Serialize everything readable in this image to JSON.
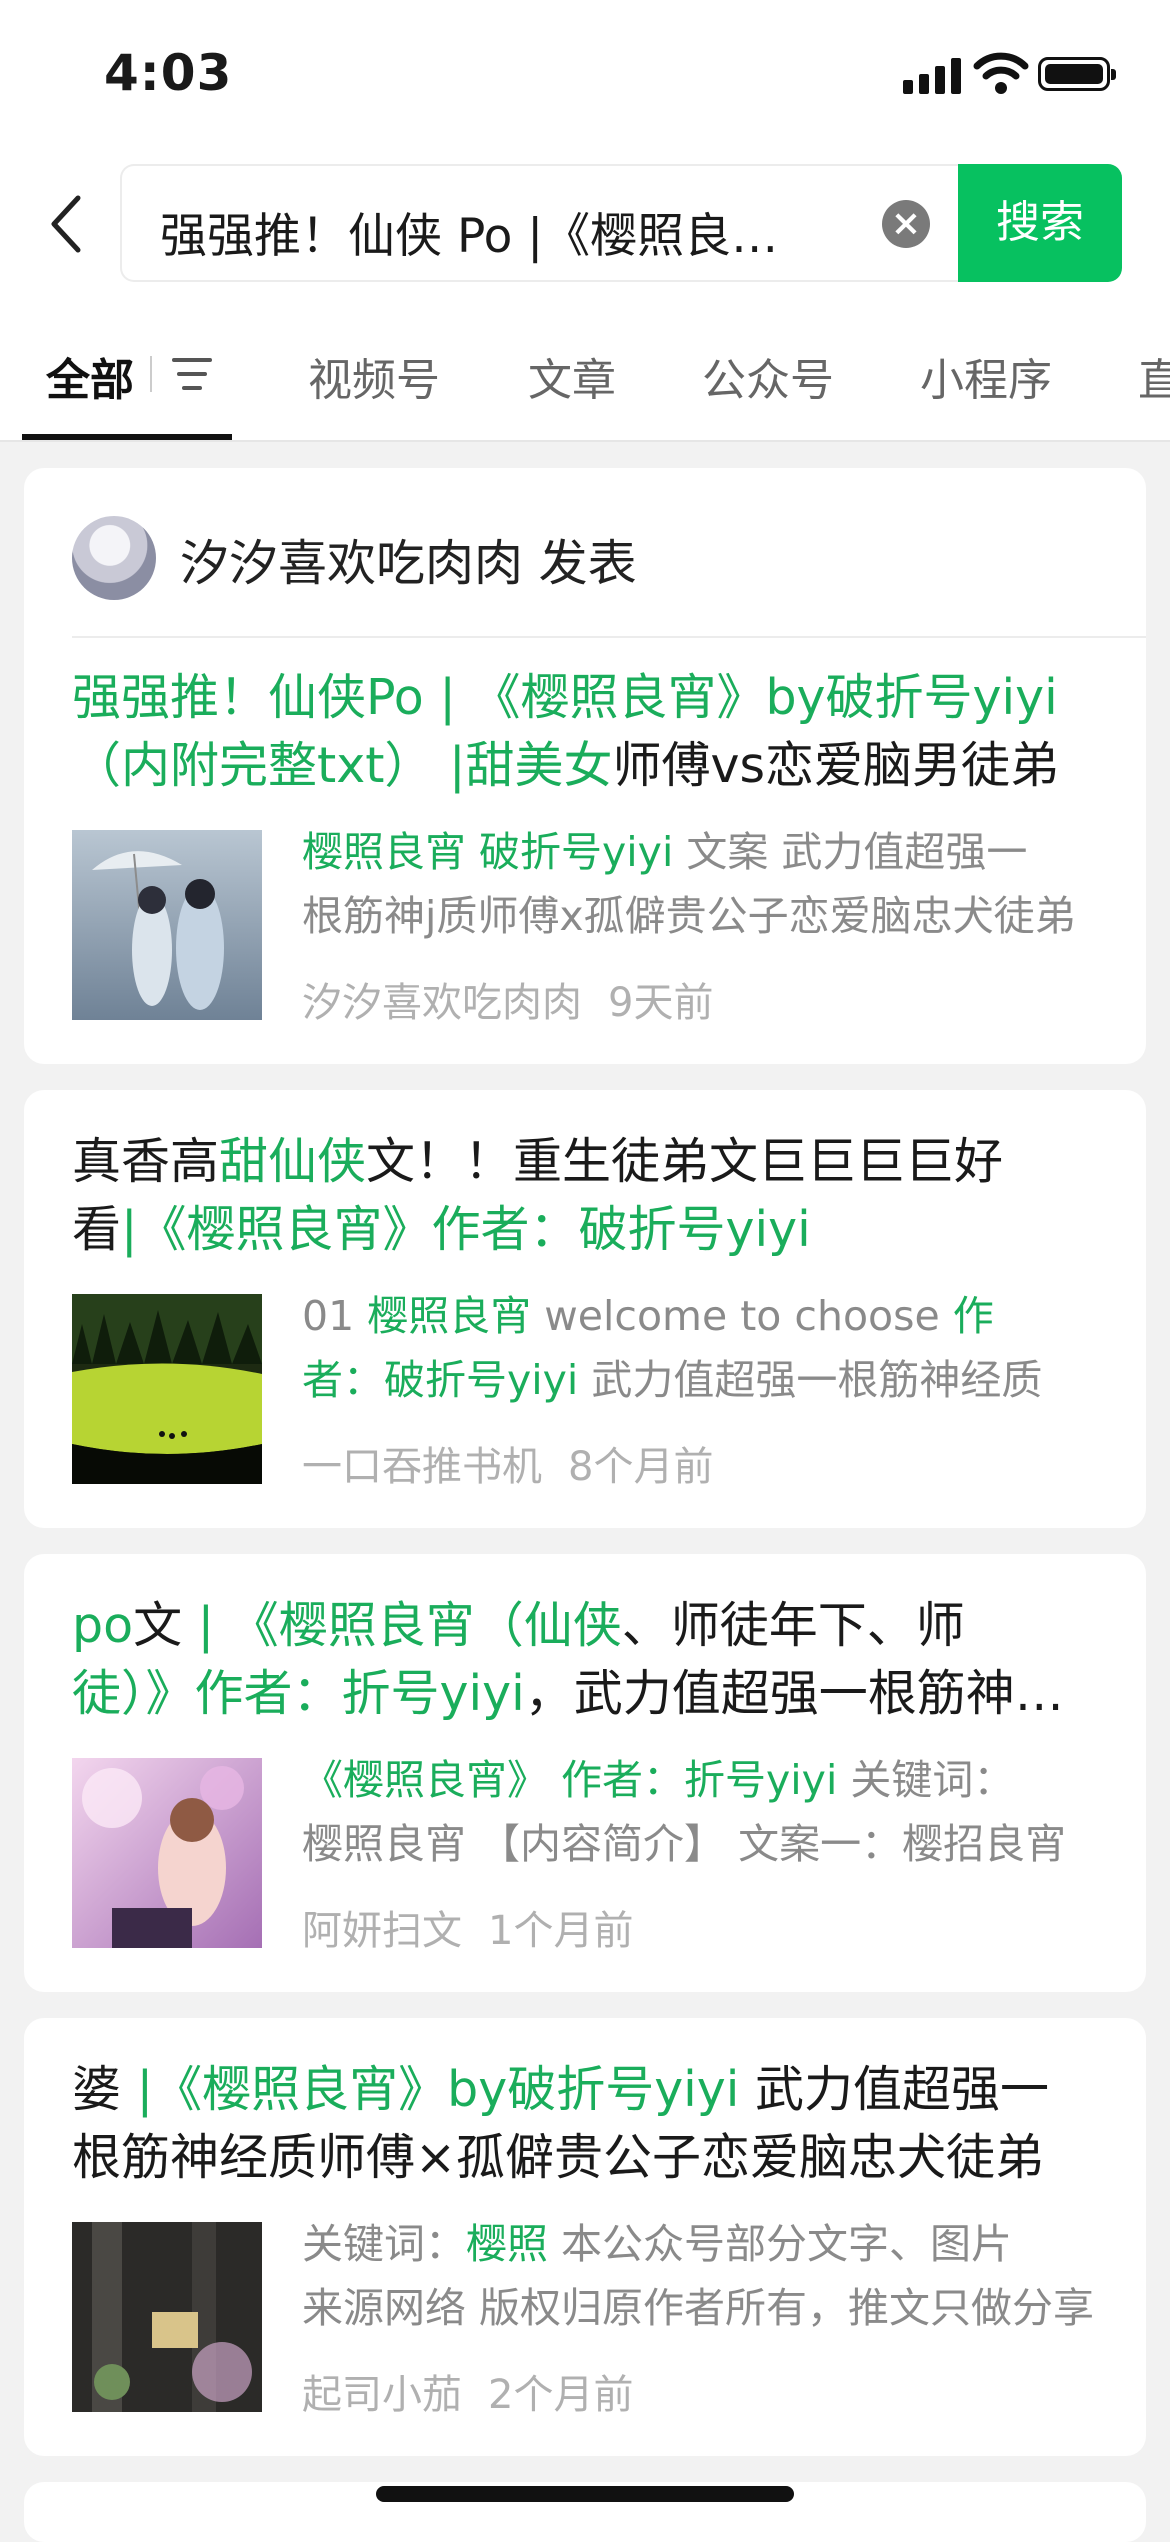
{
  "status_bar": {
    "time": "4:03"
  },
  "search": {
    "query": "强强推！仙侠 Po |《樱照良宵（仙侠、师徒年下、师徒）》",
    "button_label": "搜索"
  },
  "tabs": [
    {
      "label": "全部",
      "active": true
    },
    {
      "label": "视频号"
    },
    {
      "label": "文章"
    },
    {
      "label": "公众号"
    },
    {
      "label": "小程序"
    },
    {
      "label": "直"
    }
  ],
  "results": [
    {
      "publisher": "汐汐喜欢吃肉肉 发表",
      "title_l1": [
        "强强推！仙侠Po | 《樱照良宵》by破折号yiyi"
      ],
      "title_l2": [
        "（内附完整txt） |甜美女",
        "师傅vs恋爱脑男徒弟"
      ],
      "summary_l1": [
        "樱照良宵 破折号yiyi",
        " 文案 武力值超强一"
      ],
      "summary_l2": "根筋神j质师傅x孤僻贵公子恋爱脑忠犬徒弟",
      "author": "汐汐喜欢吃肉肉",
      "time": "9天前"
    },
    {
      "title_l1": [
        "真香高",
        "甜仙侠",
        "文！！重生徒弟文巨巨巨巨好"
      ],
      "title_l2": [
        "看",
        "|《樱照良宵》作者：破折号yiyi"
      ],
      "summary_l1": [
        "01 ",
        "樱照良宵",
        " welcome to choose ",
        "作"
      ],
      "summary_l2": [
        "者：破折号yiyi",
        " 武力值超强一根筋神经质"
      ],
      "author": "一口吞推书机",
      "time": "8个月前"
    },
    {
      "title_l1": [
        "po",
        "文",
        " | 《樱照良宵（仙侠",
        "、师徒年下、师"
      ],
      "title_l2": [
        "徒）》作者：折号yiyi",
        "，武力值超强一根筋神经质"
      ],
      "summary_l1": [
        "《樱照良宵》 作者：折号yiyi",
        " 关键词："
      ],
      "summary_l2": "樱照良宵 【内容简介】 文案一：樱招良宵",
      "author": "阿妍扫文",
      "time": "1个月前"
    },
    {
      "title_l1": [
        "婆 ",
        "|《樱照良宵》by破折号yiyi",
        " 武力值超强一"
      ],
      "title_l2": "根筋神经质师傅×孤僻贵公子恋爱脑忠犬徒弟",
      "summary_l1": [
        "关键词：",
        "樱照",
        " 本公众号部分文字、图片"
      ],
      "summary_l2": "来源网络 版权归原作者所有，推文只做分享",
      "author": "起司小茄",
      "time": "2个月前"
    }
  ],
  "colors": {
    "accent": "#1aad5b",
    "search_button": "#07c160"
  }
}
